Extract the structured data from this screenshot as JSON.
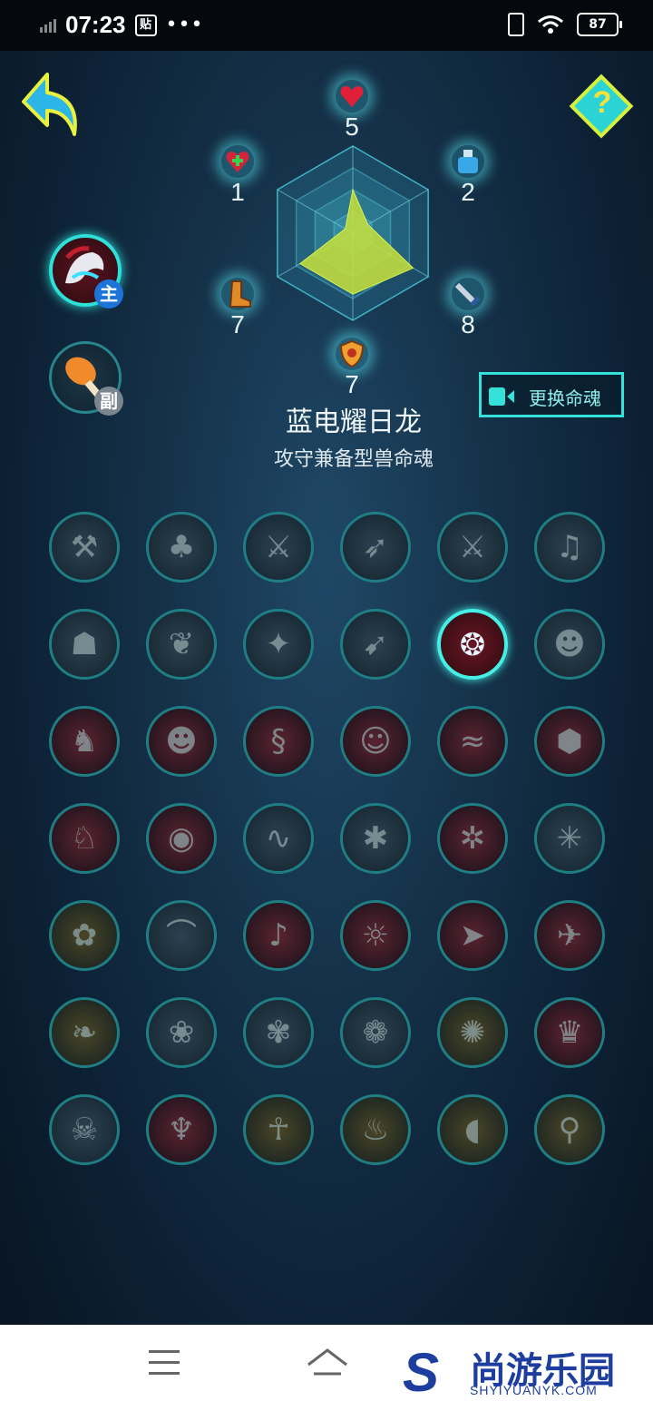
{
  "status_bar": {
    "time": "07:23",
    "notif_icon": "贴",
    "more": "•••",
    "battery": "87"
  },
  "header": {
    "help_label": "?"
  },
  "soul_slots": {
    "main_badge": "主",
    "sub_badge": "副"
  },
  "stats": [
    {
      "icon": "heart-icon",
      "value": "5"
    },
    {
      "icon": "potion-icon",
      "value": "2"
    },
    {
      "icon": "sword-icon",
      "value": "8"
    },
    {
      "icon": "shield-icon",
      "value": "7"
    },
    {
      "icon": "boot-icon",
      "value": "7"
    },
    {
      "icon": "heal-icon",
      "value": "1"
    }
  ],
  "radar_values": [
    5,
    2,
    8,
    7,
    7,
    1
  ],
  "radar_max": 10,
  "change_button": {
    "label": "更换命魂"
  },
  "soul": {
    "name": "蓝电耀日龙",
    "type": "攻守兼备型兽命魂"
  },
  "soul_grid": [
    [
      "hammer-icon",
      "tree-icon",
      "axe-icon",
      "spear-icon",
      "sword-icon",
      "bell-icon"
    ],
    [
      "mask-icon",
      "shell-icon",
      "fan-icon",
      "bow-icon",
      "dragon-icon",
      "tiger-icon"
    ],
    [
      "wolf-icon",
      "leopard-icon",
      "snake-icon",
      "cat-icon",
      "whale-icon",
      "turtle-icon"
    ],
    [
      "rabbit-icon",
      "elephant-icon",
      "worm-icon",
      "ant-icon",
      "centipede-icon",
      "spider-icon"
    ],
    [
      "butterfly-icon",
      "bat-icon",
      "bird-icon",
      "lion-icon",
      "swallow-icon",
      "eagle-icon"
    ],
    [
      "leaf-icon",
      "rose-icon",
      "iris-icon",
      "lotus-icon",
      "sunflower-icon",
      "witch-icon"
    ],
    [
      "skull-icon",
      "demon-icon",
      "angel-icon",
      "fire-spirit-icon",
      "meat-icon",
      "drumstick-icon"
    ]
  ],
  "active_cell": {
    "row": 1,
    "col": 4
  },
  "navbar": {
    "logo_mark": "S",
    "logo_text": "尚游乐园",
    "logo_url": "SHYIYUANYK.COM"
  }
}
